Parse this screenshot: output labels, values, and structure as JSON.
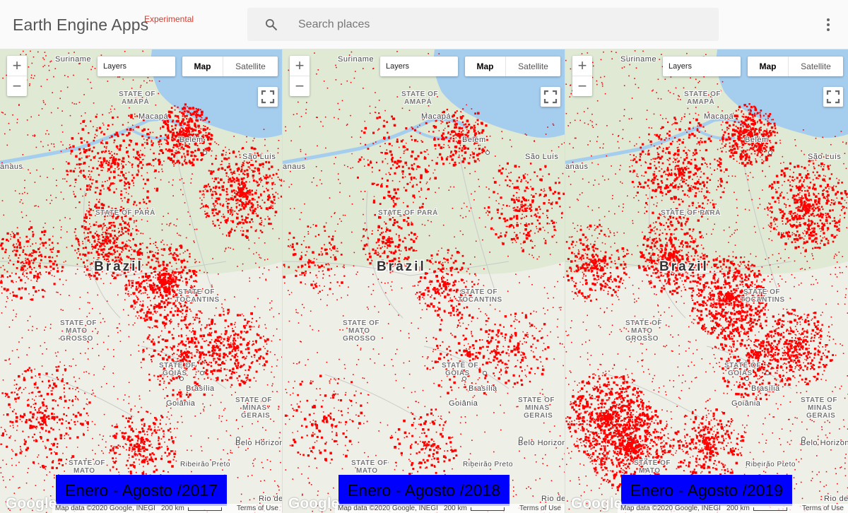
{
  "header": {
    "title": "Earth Engine Apps",
    "tag": "Experimental",
    "search_placeholder": "Search places"
  },
  "map_controls": {
    "zoom_in": "+",
    "zoom_out": "−",
    "layers_label": "Layers",
    "map_label": "Map",
    "satellite_label": "Satellite"
  },
  "map_labels": {
    "country": "Brazil",
    "amapa": "STATE OF AMAPÁ",
    "amapa_l1": "STATE OF",
    "amapa_l2": "AMAPÁ",
    "para": "STATE OF PARÁ",
    "suriname": "Suriname",
    "macapa": "Macapá",
    "belem": "Belém",
    "sao_luis": "São Luís",
    "manaus": "anaus",
    "brasilia": "Brasília",
    "goiania": "Goiânia",
    "goias_l1": "STATE OF",
    "goias_l2": "GOIÁS",
    "minas_l1": "STATE OF",
    "minas_l2": "MINAS",
    "minas_l3": "GERAIS",
    "belo": "Belo Horizonte",
    "ribeirao": "Ribeirão Preto",
    "mt_l1": "STATE OF",
    "mt_l2": "MATO",
    "mt_l3": "GROSSO",
    "tocantins_l1": "STATE OF",
    "tocantins_l2": "TOCANTINS",
    "ms_l1": "STATE OF",
    "ms_l2": "MATO",
    "ms_l3": "GROSSO",
    "rio": "Rio de J"
  },
  "footer": {
    "google": "Google",
    "attribution": "Map data ©2020 Google, INEGI",
    "scale": "200 km",
    "terms": "Terms of Use"
  },
  "panels": [
    {
      "caption": "Enero - Agosto /2017",
      "density": 0.55
    },
    {
      "caption": "Enero - Agosto /2018",
      "density": 0.35
    },
    {
      "caption": "Enero - Agosto /2019",
      "density": 0.6
    }
  ],
  "colors": {
    "fire_red": "#ff0000",
    "caption_bg": "#0000ff",
    "water": "#a5cdee",
    "land": "#eef0e7"
  }
}
